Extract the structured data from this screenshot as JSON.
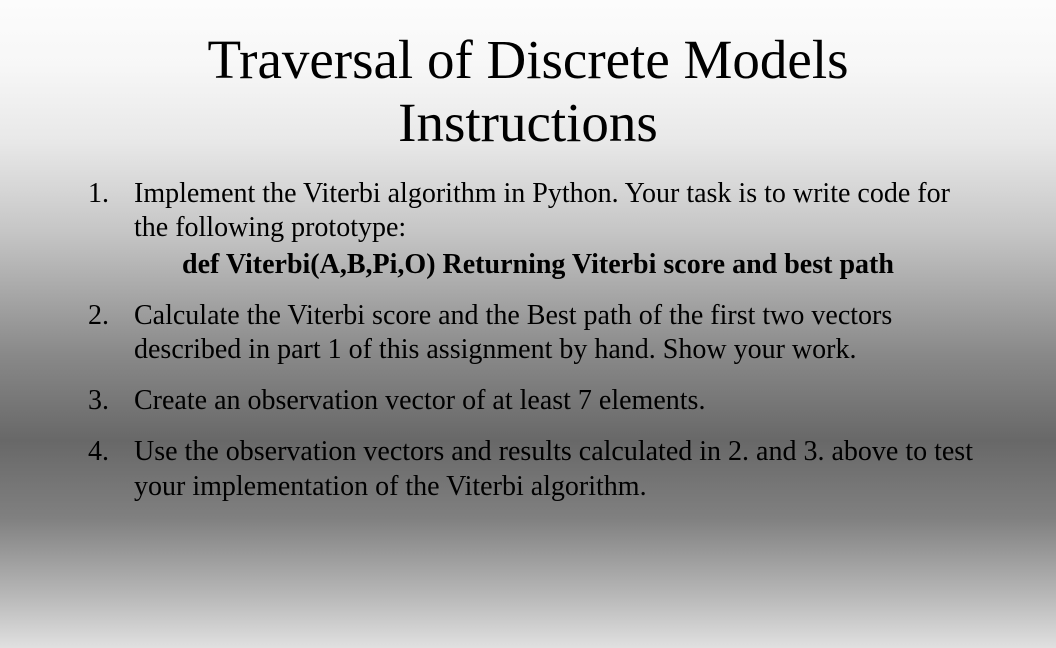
{
  "title_line1": "Traversal of Discrete Models",
  "title_line2": "Instructions",
  "items": [
    {
      "text": "Implement the Viterbi algorithm in Python. Your task is  to write code for the following prototype:",
      "prototype": "def Viterbi(A,B,Pi,O) Returning Viterbi score and best path"
    },
    {
      "text": "Calculate the Viterbi score and the Best path of the first two vectors described in part 1 of this assignment by hand. Show your work."
    },
    {
      "text": "Create an observation vector of at least 7 elements."
    },
    {
      "text": "Use the observation vectors and results calculated in 2. and 3. above to test your implementation of the Viterbi algorithm."
    }
  ]
}
